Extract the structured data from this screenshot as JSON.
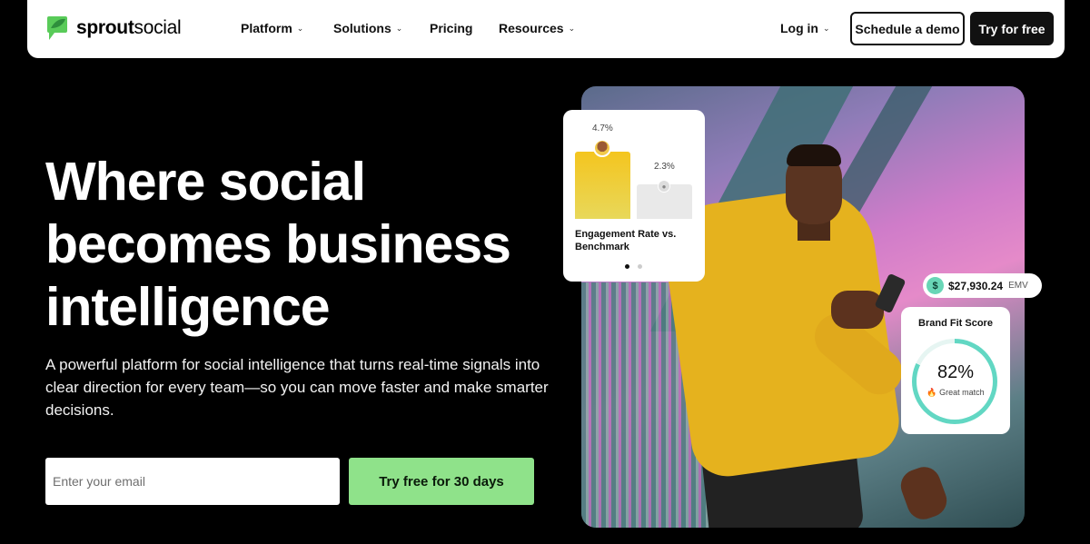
{
  "nav": {
    "logo_bold": "sprout",
    "logo_light": "social",
    "items": [
      {
        "label": "Platform",
        "has_caret": true
      },
      {
        "label": "Solutions",
        "has_caret": true
      },
      {
        "label": "Pricing",
        "has_caret": false
      },
      {
        "label": "Resources",
        "has_caret": true
      }
    ],
    "login_label": "Log in",
    "demo_label": "Schedule a demo",
    "try_label": "Try for free"
  },
  "hero": {
    "title": "Where social becomes business intelligence",
    "subtitle": "A powerful platform for social intelligence that turns real-time signals into clear direction for every team—so you can move faster and make smarter decisions.",
    "email_placeholder": "Enter your email",
    "cta_label": "Try free for 30 days"
  },
  "engagement_card": {
    "value_a": "4.7%",
    "value_b": "2.3%",
    "label": "Engagement Rate vs. Benchmark"
  },
  "emv_pill": {
    "icon": "$",
    "value": "$27,930.24",
    "suffix": "EMV"
  },
  "brand_fit": {
    "title": "Brand Fit Score",
    "value": "82%",
    "progress": 0.82,
    "sub": "Great match"
  },
  "colors": {
    "cta_green": "#8fe28a",
    "ring_teal": "#62d7c3",
    "logo_green": "#59cb59"
  }
}
